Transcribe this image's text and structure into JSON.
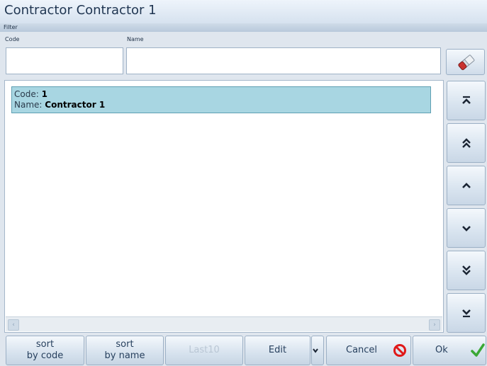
{
  "window": {
    "title": "Contractor Contractor 1"
  },
  "filter": {
    "section_label": "Filter",
    "code_label": "Code",
    "name_label": "Name",
    "code_value": "",
    "name_value": ""
  },
  "list": {
    "items": [
      {
        "code_key": "Code:",
        "code": "1",
        "name_key": "Name:",
        "name": "Contractor 1"
      }
    ]
  },
  "nav": {
    "first": "⌅",
    "page_up": "⌃⌃",
    "up": "⌃",
    "down": "⌄",
    "page_down": "⌄⌄",
    "last": "⌄"
  },
  "toolbar": {
    "sort_code_line1": "sort",
    "sort_code_line2": "by code",
    "sort_name_line1": "sort",
    "sort_name_line2": "by name",
    "last10": "Last10",
    "edit": "Edit",
    "cancel": "Cancel",
    "ok": "Ok"
  },
  "colors": {
    "selection": "#a8d6e2",
    "cancel_icon": "#e01818",
    "ok_icon": "#3aa835"
  }
}
